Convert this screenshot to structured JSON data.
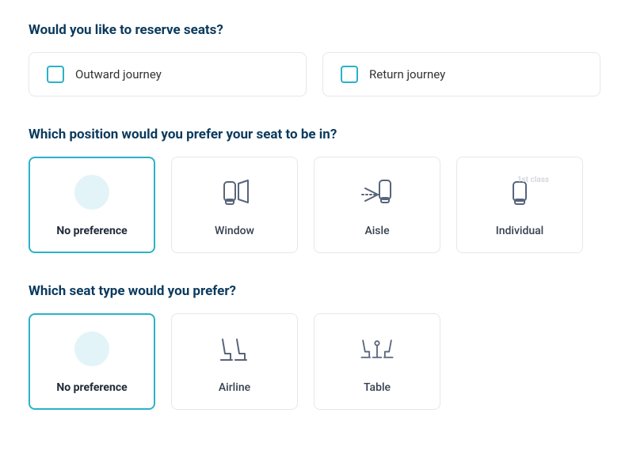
{
  "reserve_seats": {
    "title": "Would you like to reserve seats?",
    "options": {
      "outward": "Outward journey",
      "return": "Return journey"
    }
  },
  "seat_position": {
    "title": "Which position would you prefer your seat to be in?",
    "options": {
      "no_preference": "No preference",
      "window": "Window",
      "aisle": "Aisle",
      "individual": "Individual",
      "individual_badge": "1st class"
    },
    "selected": "no_preference"
  },
  "seat_type": {
    "title": "Which seat type would you prefer?",
    "options": {
      "no_preference": "No preference",
      "airline": "Airline",
      "table": "Table"
    },
    "selected": "no_preference"
  },
  "colors": {
    "accent": "#2ab2c8",
    "title": "#0b3a5d",
    "icon": "#58647b"
  }
}
